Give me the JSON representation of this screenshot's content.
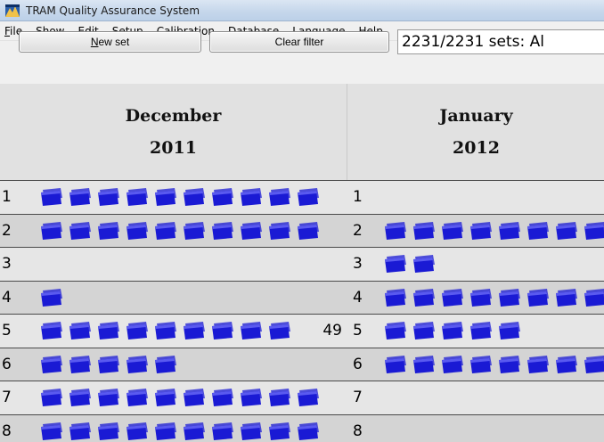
{
  "window": {
    "title": "TRAM Quality Assurance System"
  },
  "menu": {
    "items": [
      {
        "label": "File",
        "key": "F",
        "rest": "ile"
      },
      {
        "label": "Show",
        "key": "S",
        "rest": "how"
      },
      {
        "label": "Edit",
        "key": "E",
        "rest": "dit"
      },
      {
        "label": "Setup",
        "pre": "Se",
        "key": "t",
        "rest": "up"
      },
      {
        "label": "Calibration",
        "key": "C",
        "rest": "alibration"
      },
      {
        "label": "Database",
        "key": "D",
        "rest": "atabase"
      },
      {
        "label": "Language",
        "key": "L",
        "rest": "anguage"
      },
      {
        "label": "Help",
        "key": "H",
        "rest": "elp"
      }
    ]
  },
  "toolbar": {
    "new_set": {
      "key": "N",
      "rest": "ew set"
    },
    "clear_filter": "Clear filter",
    "counter": "2231/2231 sets: Al"
  },
  "calendar": {
    "set_icon_color": "#1a1ad4",
    "months": [
      {
        "name": "December",
        "year": "2011",
        "days": [
          {
            "day": "1",
            "sets": 10,
            "overflow": ""
          },
          {
            "day": "2",
            "sets": 10,
            "overflow": ""
          },
          {
            "day": "3",
            "sets": 0,
            "overflow": ""
          },
          {
            "day": "4",
            "sets": 1,
            "overflow": ""
          },
          {
            "day": "5",
            "sets": 9,
            "overflow": "49"
          },
          {
            "day": "6",
            "sets": 5,
            "overflow": ""
          },
          {
            "day": "7",
            "sets": 10,
            "overflow": ""
          },
          {
            "day": "8",
            "sets": 10,
            "overflow": ""
          }
        ]
      },
      {
        "name": "January",
        "year": "2012",
        "days": [
          {
            "day": "1",
            "sets": 0,
            "overflow": ""
          },
          {
            "day": "2",
            "sets": 8,
            "overflow": ""
          },
          {
            "day": "3",
            "sets": 2,
            "overflow": ""
          },
          {
            "day": "4",
            "sets": 8,
            "overflow": ""
          },
          {
            "day": "5",
            "sets": 5,
            "overflow": ""
          },
          {
            "day": "6",
            "sets": 8,
            "overflow": ""
          },
          {
            "day": "7",
            "sets": 0,
            "overflow": ""
          },
          {
            "day": "8",
            "sets": 0,
            "overflow": ""
          }
        ]
      }
    ]
  }
}
